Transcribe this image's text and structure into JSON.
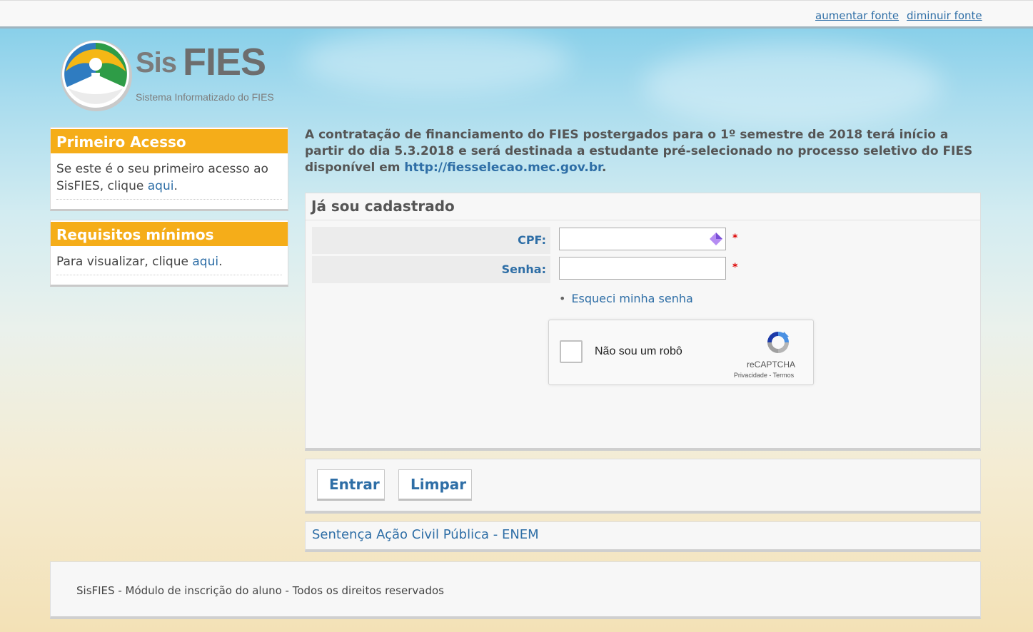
{
  "top_links": {
    "increase_font": "aumentar fonte",
    "decrease_font": "diminuir fonte"
  },
  "logo": {
    "sis": "Sis",
    "fies": "FIES",
    "subtitle": "Sistema Informatizado do FIES"
  },
  "sidebar": {
    "first_access": {
      "title": "Primeiro Acesso",
      "text": "Se este é o seu primeiro acesso ao SisFIES, clique",
      "link": "aqui",
      "end": "."
    },
    "requirements": {
      "title": "Requisitos mínimos",
      "text": "Para visualizar, clique",
      "link": "aqui",
      "end": "."
    }
  },
  "notice": {
    "text": "A contratação de financiamento do FIES postergados para o 1º semestre de 2018 terá início a partir do dia 5.3.2018 e será destinada a estudante pré-selecionado no processo seletivo do FIES disponível em",
    "url": "http://fiesselecao.mec.gov.br",
    "end": "."
  },
  "login": {
    "title": "Já sou cadastrado",
    "cpf_label": "CPF:",
    "cpf_value": "",
    "password_label": "Senha:",
    "password_value": "",
    "required_mark": "*",
    "forgot_password": "Esqueci minha senha",
    "captcha": {
      "label": "Não sou um robô",
      "brand": "reCAPTCHA",
      "terms": "Privacidade - Termos"
    }
  },
  "buttons": {
    "enter": "Entrar",
    "clear": "Limpar"
  },
  "sentence_link": "Sentença Ação Civil Pública - ENEM",
  "footer": "SisFIES - Módulo de inscrição do aluno - Todos os direitos reservados",
  "colors": {
    "accent_orange": "#f5ad19",
    "link_blue": "#2e6ea6"
  }
}
